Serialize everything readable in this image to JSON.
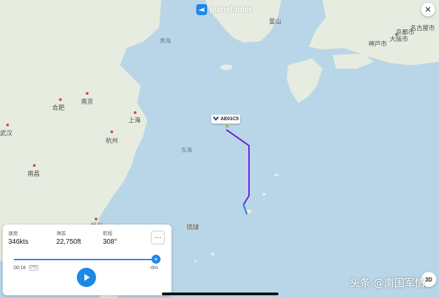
{
  "app": {
    "logo_text": "planefinder"
  },
  "map": {
    "labels": {
      "huanghai": "黄海",
      "donghai": "东海",
      "hefei": "合肥",
      "nanjing": "南京",
      "shanghai": "上海",
      "hangzhou": "杭州",
      "wuhan": "武汉",
      "nanchang": "南昌",
      "fuzhou": "福州",
      "osaka": "大阪市",
      "kobe": "神戸市",
      "nagoya": "名古屋市",
      "kyoto": "京都市",
      "busan": "釜山",
      "ryukyu": "琉球"
    }
  },
  "flight": {
    "callsign": "AE01C5"
  },
  "stats": {
    "speed_label": "速度",
    "speed_value": "346kts",
    "altitude_label": "海拔",
    "altitude_value": "22,750ft",
    "heading_label": "航程",
    "heading_value": "308°"
  },
  "playback": {
    "time_start": "00:16",
    "utc_badge": "UTC",
    "time_end": "-0m",
    "progress": 1.0
  },
  "controls": {
    "close_icon": "close-icon",
    "more_icon": "more-icon",
    "btn3d_label": "3D"
  },
  "watermark": "头条 @南国军情",
  "colors": {
    "accent": "#1e88e5",
    "track": "#6a1fd1",
    "land": "#e8efe3",
    "sea": "#b9d6e8"
  }
}
